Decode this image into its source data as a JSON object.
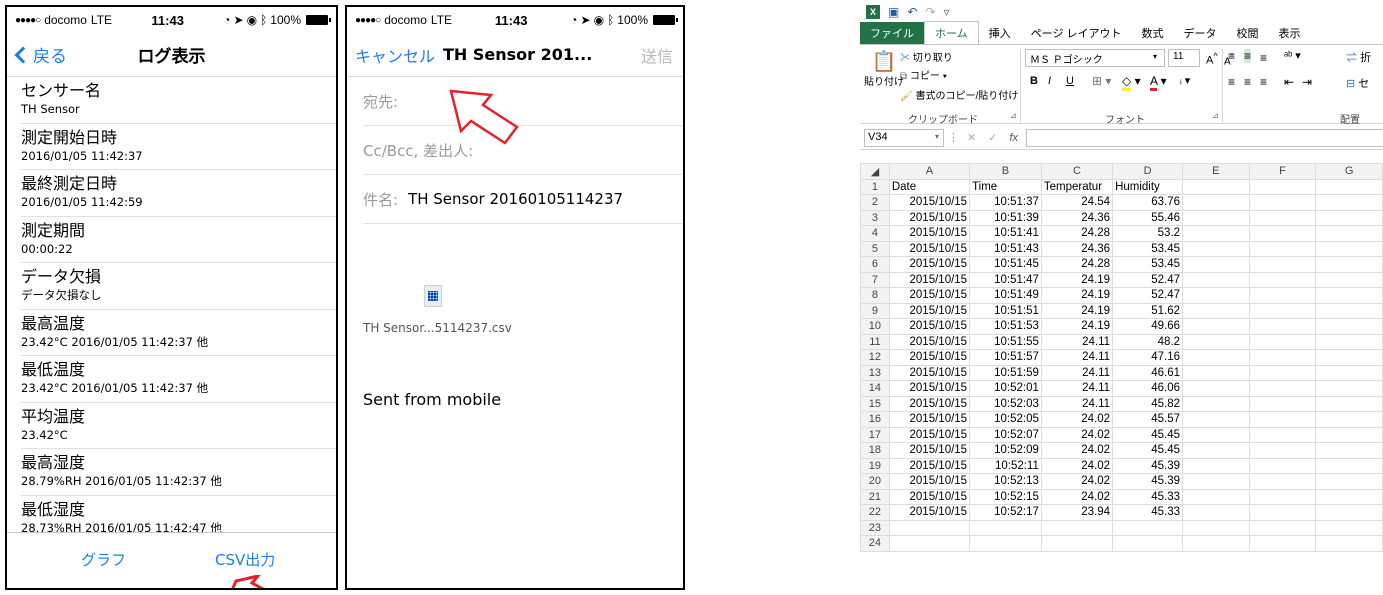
{
  "status": {
    "carrier": "docomo",
    "network": "LTE",
    "time": "11:43",
    "battery": "100%"
  },
  "log_screen": {
    "back_label": "戻る",
    "title": "ログ表示",
    "items": [
      {
        "label": "センサー名",
        "value": "TH Sensor"
      },
      {
        "label": "測定開始日時",
        "value": "2016/01/05 11:42:37"
      },
      {
        "label": "最終測定日時",
        "value": "2016/01/05 11:42:59"
      },
      {
        "label": "測定期間",
        "value": "00:00:22"
      },
      {
        "label": "データ欠損",
        "value": "データ欠損なし"
      },
      {
        "label": "最高温度",
        "value": "23.42°C 2016/01/05 11:42:37 他"
      },
      {
        "label": "最低温度",
        "value": "23.42°C 2016/01/05 11:42:37 他"
      },
      {
        "label": "平均温度",
        "value": "23.42°C"
      },
      {
        "label": "最高湿度",
        "value": "28.79%RH 2016/01/05 11:42:37 他"
      },
      {
        "label": "最低湿度",
        "value": "28.73%RH 2016/01/05 11:42:47 他"
      }
    ],
    "graph_label": "グラフ",
    "csv_label": "CSV出力"
  },
  "mail_screen": {
    "cancel_label": "キャンセル",
    "title": "TH Sensor 201...",
    "send_label": "送信",
    "to_placeholder": "宛先:",
    "cc_placeholder": "Cc/Bcc, 差出人:",
    "subject_label": "件名:",
    "subject_value": "TH Sensor 20160105114237",
    "attachment_name": "TH Sensor...5114237.csv",
    "signature": "Sent from mobile"
  },
  "excel": {
    "logo": "X",
    "tabs": [
      "ファイル",
      "ホーム",
      "挿入",
      "ページ レイアウト",
      "数式",
      "データ",
      "校閲",
      "表示"
    ],
    "clipboard": {
      "paste": "貼り付け",
      "cut": "切り取り",
      "copy": "コピー",
      "format_painter": "書式のコピー/貼り付け",
      "group": "クリップボード"
    },
    "font": {
      "name": "ＭＳ Ｐゴシック",
      "size": "11",
      "group": "フォント",
      "bold": "B",
      "italic": "I",
      "underline": "U"
    },
    "alignment_group": "配置",
    "wrap_label": "折",
    "merge_label": "セ",
    "name_box": "V34",
    "fx": "fx",
    "columns": [
      "A",
      "B",
      "C",
      "D",
      "E",
      "F",
      "G"
    ],
    "header_row": [
      "Date",
      "Time",
      "Temperatur",
      "Humidity"
    ],
    "rows": [
      [
        "2015/10/15",
        "10:51:37",
        "24.54",
        "63.76"
      ],
      [
        "2015/10/15",
        "10:51:39",
        "24.36",
        "55.46"
      ],
      [
        "2015/10/15",
        "10:51:41",
        "24.28",
        "53.2"
      ],
      [
        "2015/10/15",
        "10:51:43",
        "24.36",
        "53.45"
      ],
      [
        "2015/10/15",
        "10:51:45",
        "24.28",
        "53.45"
      ],
      [
        "2015/10/15",
        "10:51:47",
        "24.19",
        "52.47"
      ],
      [
        "2015/10/15",
        "10:51:49",
        "24.19",
        "52.47"
      ],
      [
        "2015/10/15",
        "10:51:51",
        "24.19",
        "51.62"
      ],
      [
        "2015/10/15",
        "10:51:53",
        "24.19",
        "49.66"
      ],
      [
        "2015/10/15",
        "10:51:55",
        "24.11",
        "48.2"
      ],
      [
        "2015/10/15",
        "10:51:57",
        "24.11",
        "47.16"
      ],
      [
        "2015/10/15",
        "10:51:59",
        "24.11",
        "46.61"
      ],
      [
        "2015/10/15",
        "10:52:01",
        "24.11",
        "46.06"
      ],
      [
        "2015/10/15",
        "10:52:03",
        "24.11",
        "45.82"
      ],
      [
        "2015/10/15",
        "10:52:05",
        "24.02",
        "45.57"
      ],
      [
        "2015/10/15",
        "10:52:07",
        "24.02",
        "45.45"
      ],
      [
        "2015/10/15",
        "10:52:09",
        "24.02",
        "45.45"
      ],
      [
        "2015/10/15",
        "10:52:11",
        "24.02",
        "45.39"
      ],
      [
        "2015/10/15",
        "10:52:13",
        "24.02",
        "45.39"
      ],
      [
        "2015/10/15",
        "10:52:15",
        "24.02",
        "45.33"
      ],
      [
        "2015/10/15",
        "10:52:17",
        "23.94",
        "45.33"
      ]
    ],
    "extra_row_numbers": [
      "23",
      "24"
    ]
  },
  "colors": {
    "ios_blue": "#1b7cf2",
    "arrow_red": "#e8202a",
    "excel_green": "#217346"
  }
}
